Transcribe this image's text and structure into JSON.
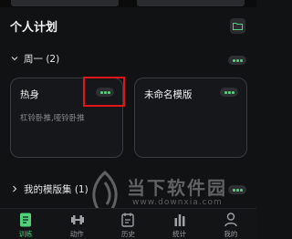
{
  "page": {
    "title": "个人计划"
  },
  "sections": {
    "week": {
      "label": "周一 (2)"
    },
    "my_templates": {
      "label": "我的模版集 (1)"
    }
  },
  "cards": [
    {
      "title": "热身",
      "subtitle": "杠铃卧推,哑铃卧推"
    },
    {
      "title": "未命名模版",
      "subtitle": ""
    }
  ],
  "watermark": {
    "text": "当下软件园",
    "url": "www.downxia.com"
  },
  "tabs": [
    {
      "label": "训练",
      "icon": "document-icon",
      "active": true
    },
    {
      "label": "动作",
      "icon": "dumbbell-icon",
      "active": false
    },
    {
      "label": "历史",
      "icon": "calendar-icon",
      "active": false
    },
    {
      "label": "统计",
      "icon": "bar-chart-icon",
      "active": false
    },
    {
      "label": "我的",
      "icon": "person-icon",
      "active": false
    }
  ],
  "colors": {
    "accent": "#4fd17a",
    "highlight": "#e01515",
    "background": "#111214"
  }
}
